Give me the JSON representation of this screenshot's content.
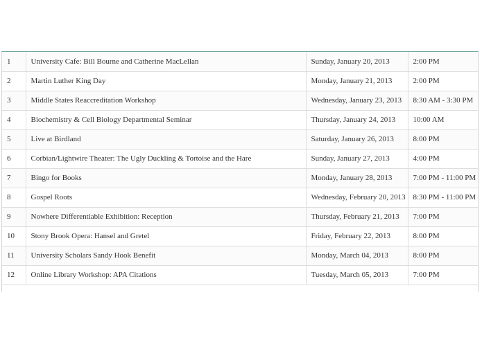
{
  "events": [
    {
      "num": "1",
      "title": "University Cafe: Bill Bourne and Catherine MacLellan",
      "date": "Sunday, January 20, 2013",
      "time": "2:00 PM"
    },
    {
      "num": "2",
      "title": "Martin Luther King Day",
      "date": "Monday, January 21, 2013",
      "time": "2:00 PM"
    },
    {
      "num": "3",
      "title": "Middle States Reaccreditation Workshop",
      "date": "Wednesday, January 23, 2013",
      "time": "8:30 AM - 3:30 PM"
    },
    {
      "num": "4",
      "title": "Biochemistry & Cell Biology Departmental Seminar",
      "date": "Thursday, January 24, 2013",
      "time": "10:00 AM"
    },
    {
      "num": "5",
      "title": "Live at Birdland",
      "date": "Saturday, January 26, 2013",
      "time": "8:00 PM"
    },
    {
      "num": "6",
      "title": "Corbian/Lightwire Theater: The Ugly Duckling & Tortoise and the Hare",
      "date": "Sunday, January 27, 2013",
      "time": "4:00 PM"
    },
    {
      "num": "7",
      "title": "Bingo for Books",
      "date": "Monday, January 28, 2013",
      "time": "7:00 PM - 11:00 PM"
    },
    {
      "num": "8",
      "title": "Gospel Roots",
      "date": "Wednesday, February 20, 2013",
      "time": "8:30 PM - 11:00 PM"
    },
    {
      "num": "9",
      "title": "Nowhere Differentiable Exhibition: Reception",
      "date": "Thursday, February 21, 2013",
      "time": "7:00 PM"
    },
    {
      "num": "10",
      "title": "Stony Brook Opera: Hansel and Gretel",
      "date": "Friday, February 22, 2013",
      "time": "8:00 PM"
    },
    {
      "num": "11",
      "title": "University Scholars Sandy Hook Benefit",
      "date": "Monday, March 04, 2013",
      "time": "8:00 PM"
    },
    {
      "num": "12",
      "title": "Online Library Workshop: APA Citations",
      "date": "Tuesday, March 05, 2013",
      "time": "7:00 PM"
    }
  ]
}
